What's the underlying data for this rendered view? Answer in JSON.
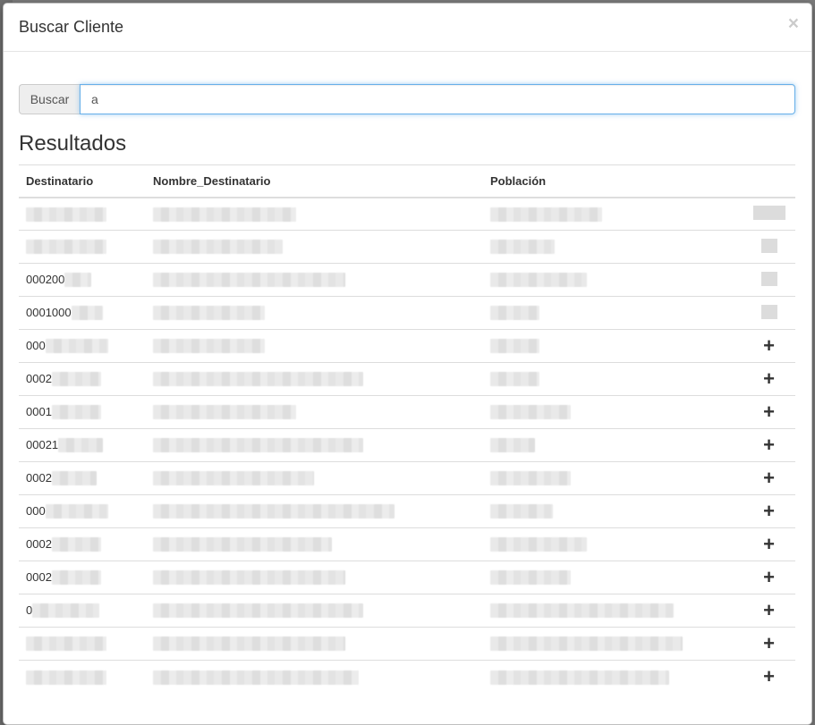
{
  "modal": {
    "title": "Buscar Cliente",
    "close_symbol": "×"
  },
  "search": {
    "button_label": "Buscar",
    "value": "a"
  },
  "results": {
    "title": "Resultados",
    "columns": [
      "Destinatario",
      "Nombre_Destinatario",
      "Población",
      ""
    ],
    "rows": [
      {
        "destinatario": "",
        "has_add": false
      },
      {
        "destinatario": "",
        "has_add": false
      },
      {
        "destinatario": "000200",
        "has_add": false
      },
      {
        "destinatario": "0001000",
        "has_add": false
      },
      {
        "destinatario": "000",
        "has_add": true
      },
      {
        "destinatario": "0002",
        "has_add": true
      },
      {
        "destinatario": "0001",
        "has_add": true
      },
      {
        "destinatario": "00021",
        "has_add": true
      },
      {
        "destinatario": "0002",
        "has_add": true
      },
      {
        "destinatario": "000",
        "has_add": true
      },
      {
        "destinatario": "0002",
        "has_add": true
      },
      {
        "destinatario": "0002",
        "has_add": true
      },
      {
        "destinatario": "0",
        "has_add": true
      },
      {
        "destinatario": "",
        "has_add": true
      },
      {
        "destinatario": "",
        "has_add": true
      }
    ],
    "add_symbol": "+"
  }
}
